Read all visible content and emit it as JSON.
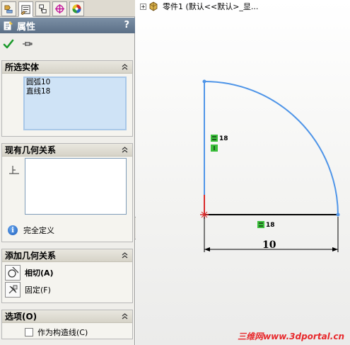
{
  "property_manager": {
    "title": "属性",
    "help": "?",
    "selected_entities": {
      "header": "所选实体",
      "items": [
        "圆弧10",
        "直线18"
      ]
    },
    "existing_relations": {
      "header": "现有几何关系",
      "status": "完全定义"
    },
    "add_relations": {
      "header": "添加几何关系",
      "tangent": "相切(A)",
      "fix": "固定(F)"
    },
    "options": {
      "header": "选项(O)",
      "construction": "作为构造线(C)"
    }
  },
  "graphics": {
    "tree_label": "零件1 (默认<<默认>_显...",
    "dimension_value": "10",
    "relation_label_1": "18",
    "relation_label_2": "18",
    "watermark": "三维网www.3dportal.cn"
  },
  "colors": {
    "accent_title": "#5b6f86",
    "sketch_blue": "#4f95e8",
    "relation_green": "#3bbf3b",
    "watermark_red": "#e8292c"
  }
}
